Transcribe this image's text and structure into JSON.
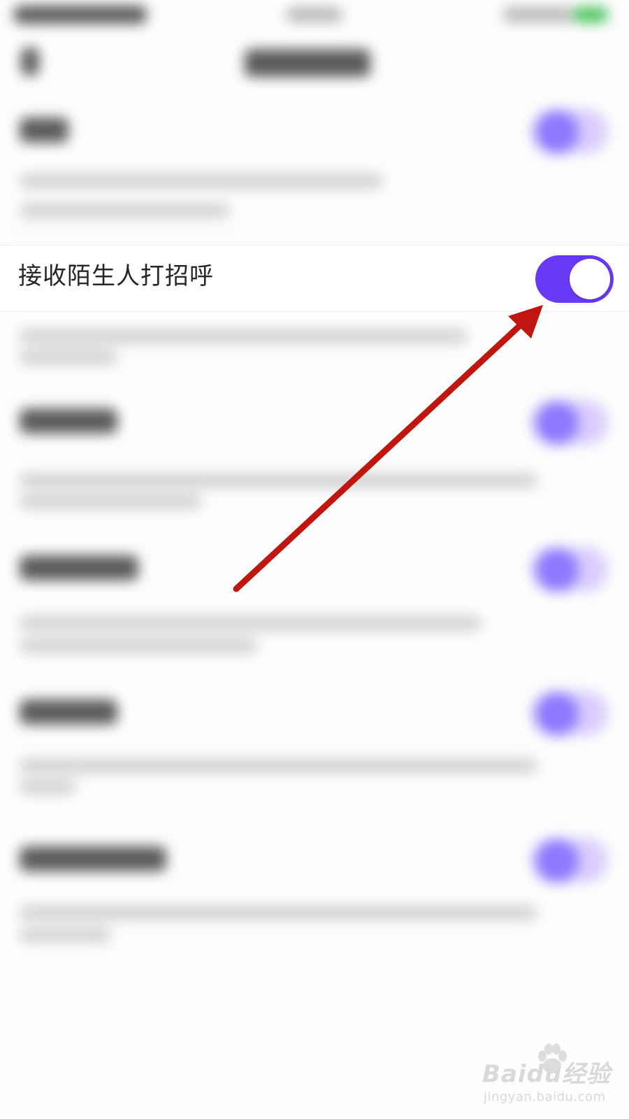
{
  "settings": {
    "receive_stranger_greetings": {
      "label": "接收陌生人打招呼",
      "enabled": true
    }
  },
  "colors": {
    "toggle_on": "#6a39f5",
    "annotation_arrow": "#c0160f"
  },
  "watermark": {
    "brand": "Baidu经验",
    "url": "jingyan.baidu.com"
  }
}
